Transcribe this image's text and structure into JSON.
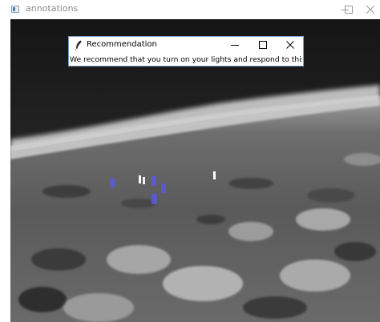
{
  "window": {
    "title": "annotations",
    "icon": "window-app-icon"
  },
  "dialog": {
    "title": "Recommendation",
    "icon": "feather-icon",
    "message": "We recommend that you turn on your lights and respond to this location."
  },
  "feed": {
    "description_icons": [
      "person-detection-marker"
    ]
  },
  "colors": {
    "detection": "#5a5ad8",
    "dialog_border": "#7a9cc8"
  }
}
